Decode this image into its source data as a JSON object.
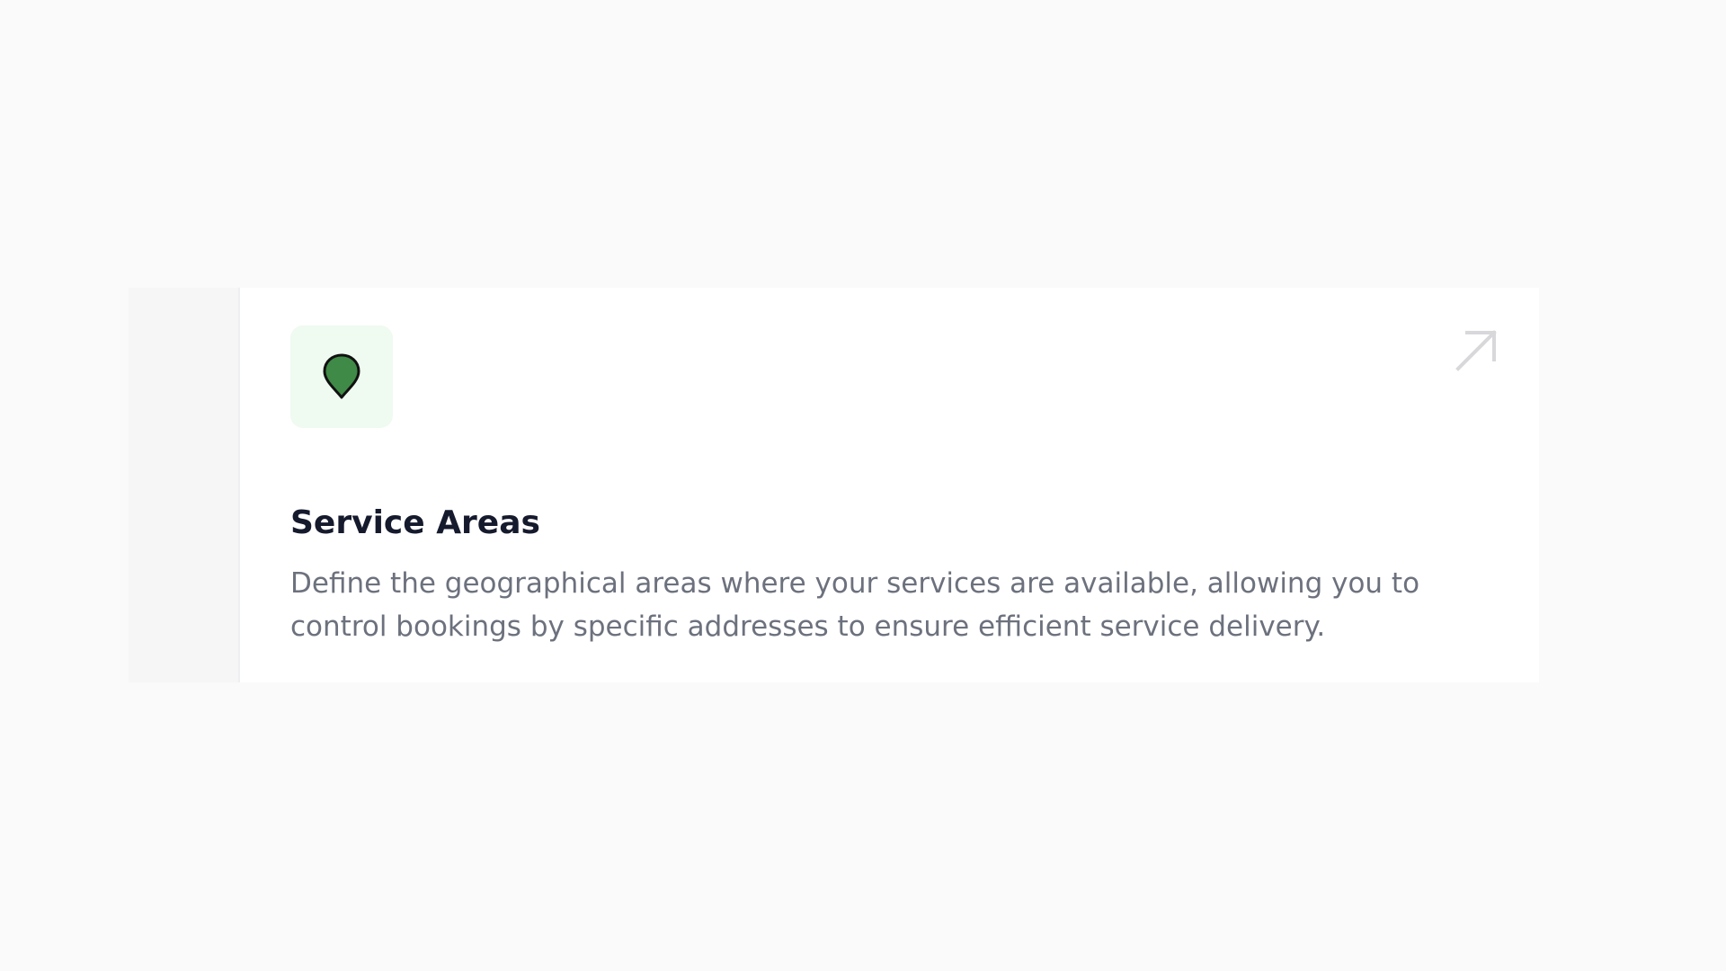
{
  "card": {
    "icon": "map-pin-icon",
    "title": "Service Areas",
    "description": "Define the geographical areas where your services are available, allowing you to control bookings by specific addresses to ensure efficient service delivery.",
    "link_icon": "arrow-up-right-icon"
  },
  "colors": {
    "page_background": "#fafafa",
    "card_background": "#ffffff",
    "icon_tile_background": "#effaf1",
    "pin_fill": "#3f8a46",
    "pin_stroke": "#111111",
    "title": "#151a2d",
    "description": "#6c717d",
    "arrow": "#d8d8db"
  }
}
